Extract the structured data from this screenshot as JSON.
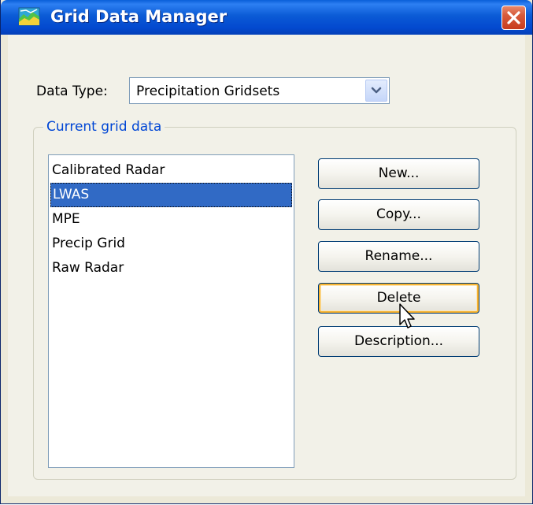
{
  "window": {
    "title": "Grid Data Manager",
    "icon": "grid-data-icon",
    "close_icon": "close-icon"
  },
  "data_type": {
    "label": "Data Type:",
    "selected": "Precipitation Gridsets"
  },
  "group": {
    "label": "Current grid data"
  },
  "list": {
    "items": [
      {
        "label": "Calibrated Radar",
        "selected": false
      },
      {
        "label": "LWAS",
        "selected": true
      },
      {
        "label": "MPE",
        "selected": false
      },
      {
        "label": "Precip Grid",
        "selected": false
      },
      {
        "label": "Raw Radar",
        "selected": false
      }
    ]
  },
  "buttons": {
    "new": "New...",
    "copy": "Copy...",
    "rename": "Rename...",
    "delete": "Delete",
    "description": "Description..."
  },
  "colors": {
    "title_bar": "#0349cf",
    "selection": "#316ac5",
    "group_label": "#0046d5",
    "close_button": "#c83c1e"
  }
}
